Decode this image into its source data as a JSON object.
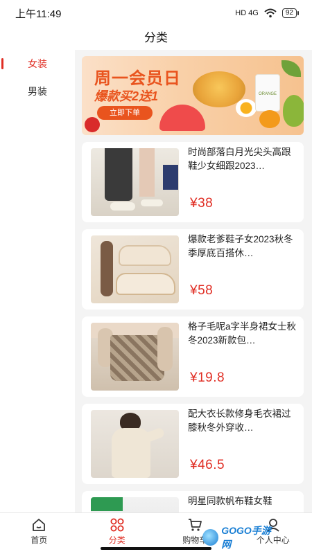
{
  "status_bar": {
    "time": "上午11:49",
    "signal": "HD 4G",
    "battery": "92"
  },
  "header": {
    "title": "分类"
  },
  "sidebar": {
    "items": [
      {
        "label": "女装",
        "active": true
      },
      {
        "label": "男装",
        "active": false
      }
    ]
  },
  "banner": {
    "title": "周一会员日",
    "subtitle": "爆款买2送1",
    "button": "立即下单",
    "jar_label": "ORANGE"
  },
  "products": [
    {
      "title": "时尚部落白月光尖头高跟鞋少女细跟2023…",
      "price": "¥38"
    },
    {
      "title": "爆款老爹鞋子女2023秋冬季厚底百搭休…",
      "price": "¥58"
    },
    {
      "title": "格子毛呢a字半身裙女士秋冬2023新款包…",
      "price": "¥19.8"
    },
    {
      "title": "配大衣长款修身毛衣裙过膝秋冬外穿收…",
      "price": "¥46.5"
    },
    {
      "title": "明星同款帆布鞋女鞋",
      "price": ""
    }
  ],
  "tabbar": {
    "tabs": [
      {
        "label": "首页",
        "icon": "home-icon",
        "active": false
      },
      {
        "label": "分类",
        "icon": "grid-icon",
        "active": true
      },
      {
        "label": "购物车",
        "icon": "cart-icon",
        "active": false
      },
      {
        "label": "个人中心",
        "icon": "user-icon",
        "active": false
      }
    ]
  },
  "watermark": {
    "text": "GOGO手游网"
  },
  "colors": {
    "accent": "#e02e24",
    "banner_orange": "#e9541e",
    "background": "#f4f4f4"
  }
}
